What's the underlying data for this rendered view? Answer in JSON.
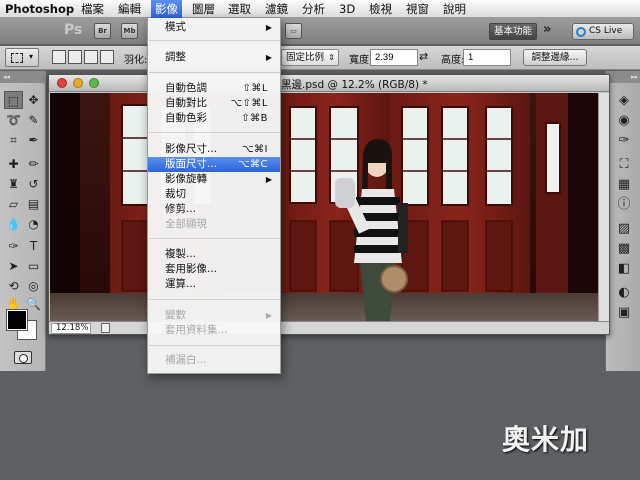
{
  "menubar": {
    "app_name": "Photoshop",
    "items": [
      {
        "label": "檔案"
      },
      {
        "label": "編輯"
      },
      {
        "label": "影像",
        "active": true
      },
      {
        "label": "圖層"
      },
      {
        "label": "選取"
      },
      {
        "label": "濾鏡"
      },
      {
        "label": "分析"
      },
      {
        "label": "3D"
      },
      {
        "label": "檢視"
      },
      {
        "label": "視窗"
      },
      {
        "label": "說明"
      }
    ]
  },
  "appbar": {
    "logo_text": "Ps",
    "buttons": [
      "Br",
      "Mb"
    ],
    "workspace_label": "基本功能",
    "more_glyph": "»",
    "cslive_label": "CS Live"
  },
  "options": {
    "feather_label": "羽化:",
    "style_value": "固定比例",
    "width_label": "寬度:",
    "width_value": "2.39",
    "height_label": "高度:",
    "height_value": "1",
    "refine_edge_label": "調整邊緣..."
  },
  "document": {
    "title_suffix": "黑邊.psd @ 12.2% (RGB/8) *",
    "zoom_readout": "12.18%"
  },
  "image_menu": {
    "items": [
      {
        "label": "模式",
        "submenu": true
      },
      {
        "sep": true
      },
      {
        "label": "調整",
        "submenu": true
      },
      {
        "sep": true
      },
      {
        "label": "自動色調",
        "shortcut": "⇧⌘L"
      },
      {
        "label": "自動對比",
        "shortcut": "⌥⇧⌘L"
      },
      {
        "label": "自動色彩",
        "shortcut": "⇧⌘B"
      },
      {
        "sep": true
      },
      {
        "label": "影像尺寸...",
        "shortcut": "⌥⌘I"
      },
      {
        "label": "版面尺寸...",
        "shortcut": "⌥⌘C",
        "highlighted": true
      },
      {
        "label": "影像旋轉",
        "submenu": true
      },
      {
        "label": "裁切"
      },
      {
        "label": "修剪..."
      },
      {
        "label": "全部顯現",
        "disabled": true
      },
      {
        "sep": true
      },
      {
        "label": "複製..."
      },
      {
        "label": "套用影像..."
      },
      {
        "label": "運算..."
      },
      {
        "sep": true
      },
      {
        "label": "變數",
        "submenu": true,
        "disabled": true
      },
      {
        "label": "套用資料集...",
        "disabled": true
      },
      {
        "sep": true
      },
      {
        "label": "補漏白...",
        "disabled": true
      }
    ]
  },
  "watermark": "奧米加",
  "colors": {
    "menu_highlight": "#2d63d8",
    "foreground_color": "#000000",
    "background_color": "#ffffff",
    "close_red": "#e0443c",
    "min_yellow": "#e6a92b",
    "zoom_green": "#5cb84a"
  }
}
